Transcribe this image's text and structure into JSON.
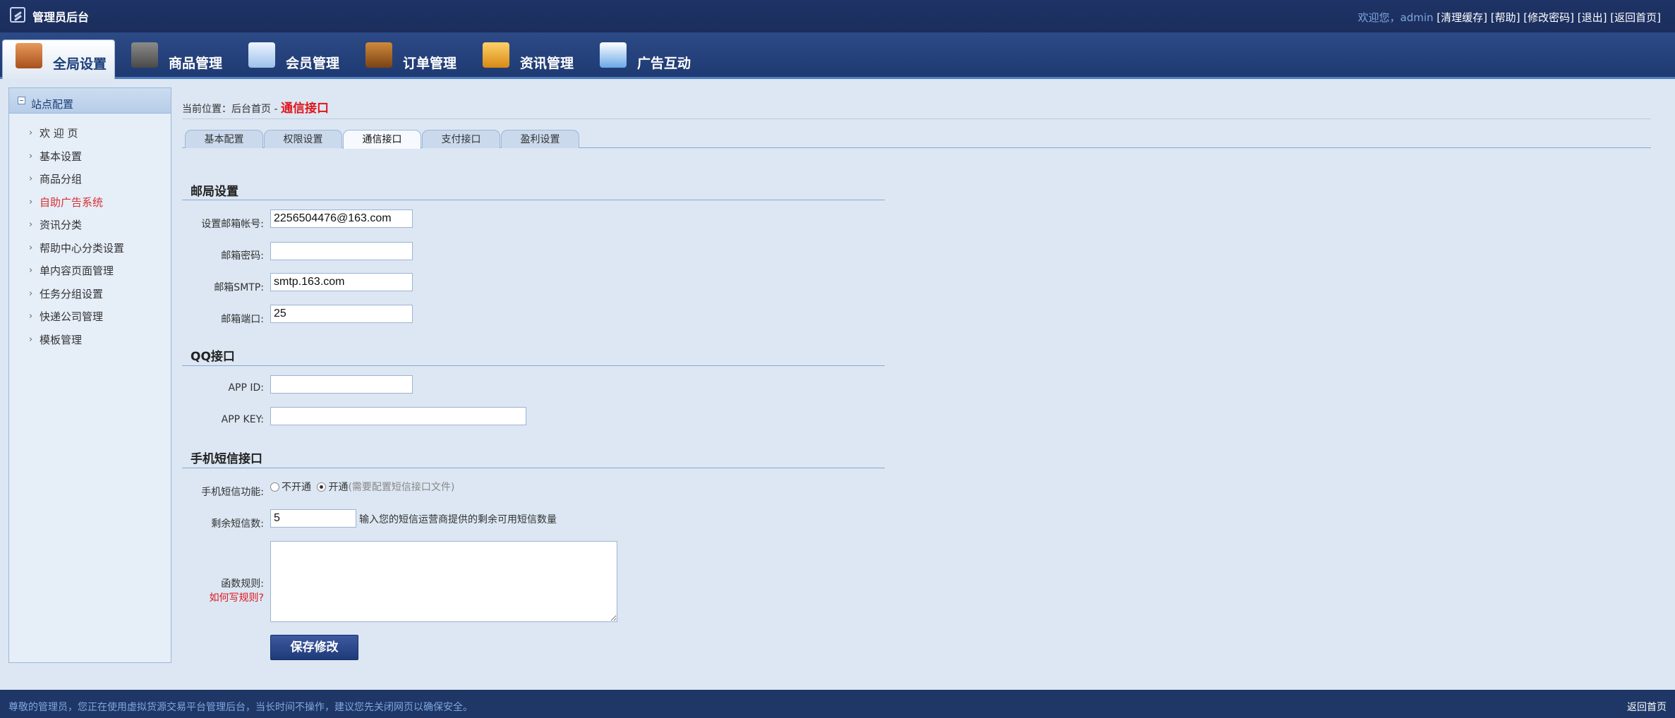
{
  "header": {
    "brand": "管理员后台",
    "welcome": "欢迎您，admin",
    "links": [
      "[清理缓存]",
      "[帮助]",
      "[修改密码]",
      "[退出]",
      "[返回首页]"
    ]
  },
  "nav": {
    "tabs": [
      {
        "label": "全局设置",
        "icon": "settings-icon",
        "color": "#c96a2b"
      },
      {
        "label": "商品管理",
        "icon": "grid-icon",
        "color": "#5a5a5a"
      },
      {
        "label": "会员管理",
        "icon": "member-card-icon",
        "color": "#3b7dd8"
      },
      {
        "label": "订单管理",
        "icon": "wallet-icon",
        "color": "#a86a28"
      },
      {
        "label": "资讯管理",
        "icon": "folder-icon",
        "color": "#e0a020"
      },
      {
        "label": "广告互动",
        "icon": "window-icon",
        "color": "#3a8ad8"
      }
    ],
    "active_index": 0
  },
  "sidebar": {
    "title": "站点配置",
    "items": [
      {
        "label": "欢 迎 页",
        "highlight": false
      },
      {
        "label": "基本设置",
        "highlight": false
      },
      {
        "label": "商品分组",
        "highlight": false
      },
      {
        "label": "自助广告系统",
        "highlight": true
      },
      {
        "label": "资讯分类",
        "highlight": false
      },
      {
        "label": "帮助中心分类设置",
        "highlight": false
      },
      {
        "label": "单内容页面管理",
        "highlight": false
      },
      {
        "label": "任务分组设置",
        "highlight": false
      },
      {
        "label": "快递公司管理",
        "highlight": false
      },
      {
        "label": "模板管理",
        "highlight": false
      }
    ]
  },
  "breadcrumb": {
    "prefix": "当前位置：后台首页 - ",
    "current": "通信接口"
  },
  "subtabs": [
    "基本配置",
    "权限设置",
    "通信接口",
    "支付接口",
    "盈利设置"
  ],
  "mail": {
    "section_title": "邮局设置",
    "account_label": "设置邮箱帐号:",
    "account_value": "2256504476@163.com",
    "password_label": "邮箱密码:",
    "password_value": "",
    "smtp_label": "邮箱SMTP:",
    "smtp_value": "smtp.163.com",
    "port_label": "邮箱端口:",
    "port_value": "25"
  },
  "qq": {
    "section_title": "QQ接口",
    "appid_label": "APP ID:",
    "appid_value": "",
    "appkey_label": "APP KEY:",
    "appkey_value": ""
  },
  "sms": {
    "section_title": "手机短信接口",
    "func_label": "手机短信功能:",
    "option_off": "不开通",
    "option_on": "开通",
    "option_on_hint": "(需要配置短信接口文件)",
    "selected": "开通",
    "remain_label": "剩余短信数:",
    "remain_value": "5",
    "remain_hint": "输入您的短信运营商提供的剩余可用短信数量",
    "rule_label": "函数规则:",
    "rule_link": "如何写规则?",
    "rule_value": ""
  },
  "save_label": "保存修改",
  "footer": {
    "notice": "尊敬的管理员，您正在使用虚拟货源交易平台管理后台，当长时间不操作，建议您先关闭网页以确保安全。",
    "home_link": "返回首页"
  }
}
